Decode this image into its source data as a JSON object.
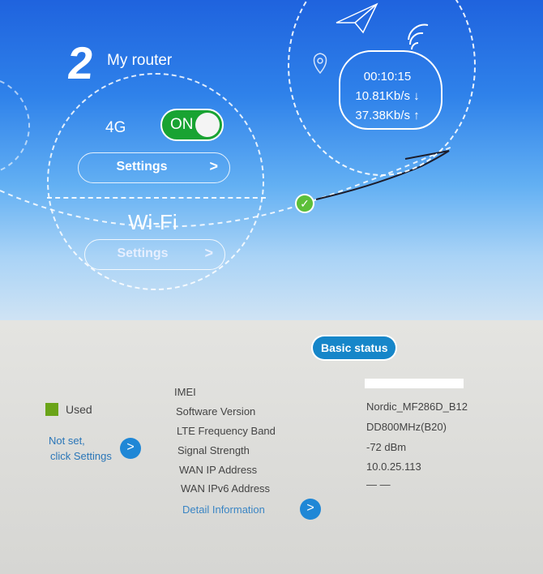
{
  "router": {
    "step_number": "2",
    "title": "My router",
    "lte_label": "4G",
    "lte_toggle": "ON",
    "lte_settings": "Settings",
    "wifi_label": "Wi-Fi",
    "wifi_settings": "Settings",
    "chevron": ">"
  },
  "connection": {
    "duration": "00:10:15",
    "download": "10.81Kb/s ↓",
    "upload": "37.38Kb/s ↑",
    "status_check": "✓"
  },
  "basic_status": {
    "badge": "Basic status",
    "rows": [
      {
        "key": "IMEI",
        "value": ""
      },
      {
        "key": "Software Version",
        "value": "Nordic_MF286D_B12"
      },
      {
        "key": "LTE Frequency Band",
        "value": "DD800MHz(B20)"
      },
      {
        "key": "Signal Strength",
        "value": "-72 dBm"
      },
      {
        "key": "WAN IP Address",
        "value": "10.0.25.113"
      },
      {
        "key": "WAN IPv6 Address",
        "value": "— —"
      }
    ],
    "detail_link": "Detail Information"
  },
  "data_usage": {
    "used_label": "Used",
    "not_set": "Not set,",
    "click_settings": "click Settings"
  },
  "colors": {
    "toggle_on": "#19a332",
    "accent_blue": "#1f87d6",
    "used_green": "#6aa418",
    "check_green": "#5cbf39"
  }
}
